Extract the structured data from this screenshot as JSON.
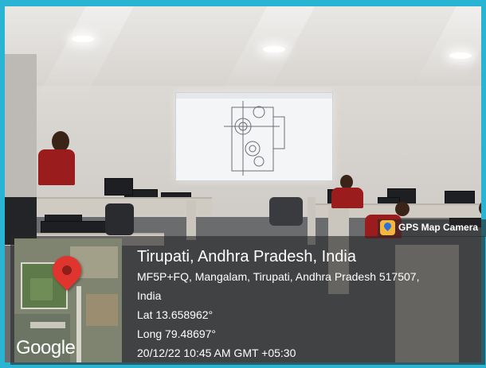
{
  "gps_badge": {
    "label": "GPS Map Camera",
    "icon": "map-pin-icon"
  },
  "location": {
    "title": "Tirupati, Andhra Pradesh, India",
    "address_line1": "MF5P+FQ, Mangalam, Tirupati, Andhra Pradesh 517507,",
    "address_line2": "India",
    "lat": "Lat 13.658962°",
    "long": "Long 79.48697°",
    "datetime": "20/12/22 10:45 AM GMT +05:30"
  },
  "map": {
    "brand": "Google",
    "pin_icon": "location-pin-icon"
  },
  "colors": {
    "frame": "#29b4d4",
    "pin": "#e0352e",
    "shirt": "#9b1c1c"
  }
}
